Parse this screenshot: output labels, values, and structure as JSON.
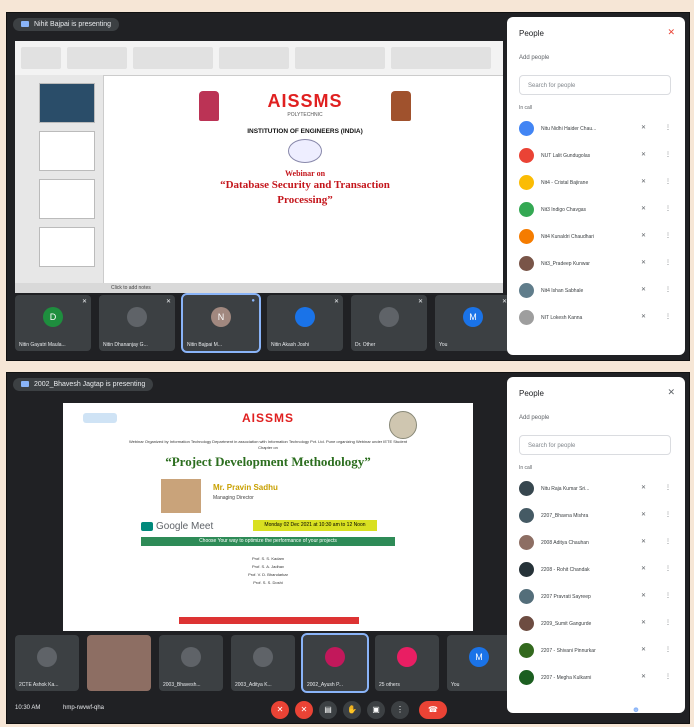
{
  "screen1": {
    "banner": "Nihit Bajpai is presenting",
    "tiles": [
      {
        "initial": "D",
        "color": "#1e8e3e",
        "name": "Nitin Gayatri Maula..."
      },
      {
        "initial": "",
        "color": "#5f6368",
        "name": "Nitin Dhananjay G..."
      },
      {
        "initial": "N",
        "color": "#a1887f",
        "name": "Nitin Bajpai M..."
      },
      {
        "initial": "",
        "color": "#1a73e8",
        "name": "Nitin Akash Joshi"
      },
      {
        "initial": "",
        "color": "#5f6368",
        "name": "Dr. Other"
      },
      {
        "initial": "M",
        "color": "#1a73e8",
        "name": "You"
      }
    ],
    "slide": {
      "title": "AISSMS",
      "subtitle": "POLYTECHNIC",
      "institution": "INSTITUTION OF ENGINEERS (INDIA)",
      "webinar": "Webinar on",
      "topic": "“Database Security and Transaction Processing”",
      "status": "Click to add notes"
    },
    "people": {
      "title": "People",
      "add": "Add people",
      "search_placeholder": "Search for people",
      "section": "In call",
      "list": [
        {
          "name": "Nitu Nidhi Haider Chau...",
          "color": "#4285f4"
        },
        {
          "name": "NUT Lalit Gundugolas",
          "color": "#ea4335"
        },
        {
          "name": "Nit4 - Cristal Bajirane",
          "color": "#fbbc04"
        },
        {
          "name": "Nit3 Indigo Chavgas",
          "color": "#34a853"
        },
        {
          "name": "Nit4 Kunaldri Chaudhari",
          "color": "#f57c00"
        },
        {
          "name": "Nit3_Pradeep Kunwar",
          "color": "#795548"
        },
        {
          "name": "Nit4 Ishan Sabhale",
          "color": "#607d8b"
        },
        {
          "name": "NIT Lokesh Kanna",
          "color": "#9e9e9e"
        }
      ]
    }
  },
  "screen2": {
    "banner": "2002_Bhavesh Jagtap is presenting",
    "tiles": [
      {
        "initial": "",
        "color": "#5f6368",
        "name": "2CTE Ashok Ka..."
      },
      {
        "initial": "",
        "color": "#8d6e63",
        "name": ""
      },
      {
        "initial": "",
        "color": "#5f6368",
        "name": "2003_Bhavesh..."
      },
      {
        "initial": "",
        "color": "#5f6368",
        "name": "2003_Aditya K..."
      },
      {
        "initial": "",
        "color": "#c2185b",
        "name": "2002_Ayush P..."
      },
      {
        "initial": "",
        "color": "#e91e63",
        "name": "25 others"
      },
      {
        "initial": "M",
        "color": "#1a73e8",
        "name": "You"
      }
    ],
    "poster": {
      "title": "AISSMS",
      "header": "Webinar Organized by Information Technology Department in association with Information Technology Pvt. Ltd. Pune organizing Webinar under IETE Student Chapter on",
      "topic": "“Project Development Methodology”",
      "speaker": "Mr. Pravin Sadhu",
      "speaker_role": "Managing Director",
      "google_meet": "Google Meet",
      "date": "Monday 02 Dec 2021 at 10:30 am to 12 Noon",
      "green_line": "Choose Your way to optimize the performance of your projects",
      "coordinators": [
        "Prof. S. S. Kadam",
        "Prof. S. A. Jadhav",
        "Prof. V. D. Bhandarkar",
        "Prof. S. S. Doshi"
      ]
    },
    "people": {
      "title": "People",
      "add": "Add people",
      "search_placeholder": "Search for people",
      "section": "In call",
      "list": [
        {
          "name": "Nitu Raja Kumar Sri..."
        },
        {
          "name": "2207_Bhavna Mishra"
        },
        {
          "name": "2008 Aditya Chauhan"
        },
        {
          "name": "2208 - Rohit Chandak"
        },
        {
          "name": "2207 Pravrati Sayreep"
        },
        {
          "name": "2209_Sumit Gangurde"
        },
        {
          "name": "2207 - Shivani Pinnurkar"
        },
        {
          "name": "2207 - Megha Kulkarni"
        }
      ]
    },
    "controls": {
      "time": "10:30 AM",
      "meeting": "hmp-rwvwf-qha"
    }
  }
}
